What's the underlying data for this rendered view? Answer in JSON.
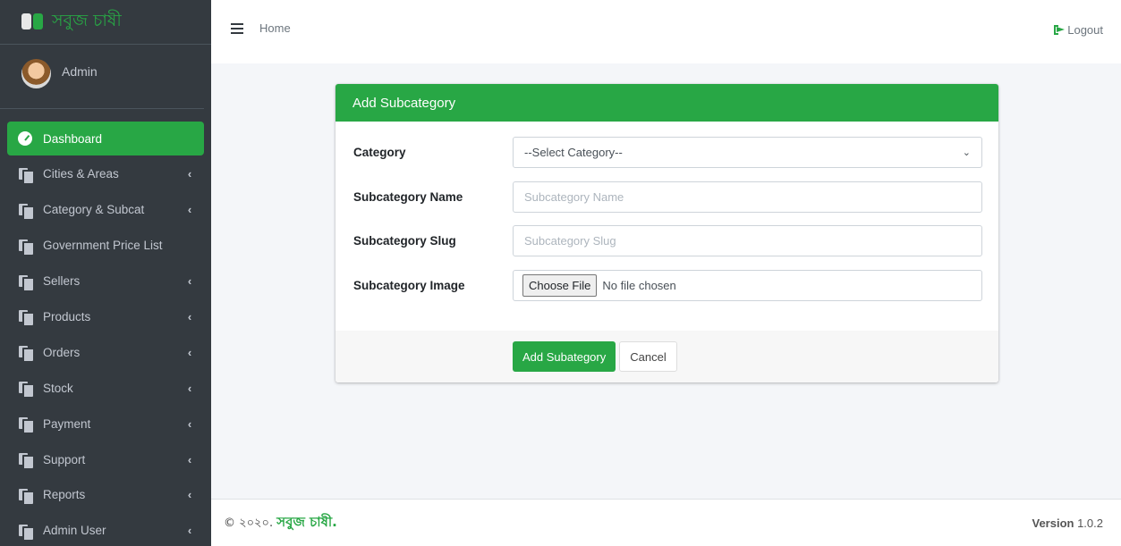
{
  "brand": {
    "name": "সবুজ চাষী"
  },
  "user": {
    "name": "Admin"
  },
  "sidebar": {
    "items": [
      {
        "label": "Dashboard",
        "icon": "dashboard-icon",
        "active": true,
        "chevron": ""
      },
      {
        "label": "Cities & Areas",
        "icon": "copy-icon",
        "chevron": "‹"
      },
      {
        "label": "Category & Subcat",
        "icon": "copy-icon",
        "chevron": "‹"
      },
      {
        "label": "Government Price List",
        "icon": "copy-icon",
        "chevron": ""
      },
      {
        "label": "Sellers",
        "icon": "copy-icon",
        "chevron": "‹"
      },
      {
        "label": "Products",
        "icon": "copy-icon",
        "chevron": "‹"
      },
      {
        "label": "Orders",
        "icon": "copy-icon",
        "chevron": "‹"
      },
      {
        "label": "Stock",
        "icon": "copy-icon",
        "chevron": "‹"
      },
      {
        "label": "Payment",
        "icon": "copy-icon",
        "chevron": "‹"
      },
      {
        "label": "Support",
        "icon": "copy-icon",
        "chevron": "‹"
      },
      {
        "label": "Reports",
        "icon": "copy-icon",
        "chevron": "‹"
      },
      {
        "label": "Admin User",
        "icon": "copy-icon",
        "chevron": "‹"
      }
    ]
  },
  "topbar": {
    "home_label": "Home",
    "logout_label": "Logout"
  },
  "card": {
    "title": "Add Subcategory",
    "fields": {
      "category": {
        "label": "Category",
        "value": "--Select Category--"
      },
      "name": {
        "label": "Subcategory Name",
        "placeholder": "Subcategory Name"
      },
      "slug": {
        "label": "Subcategory Slug",
        "placeholder": "Subcategory Slug"
      },
      "image": {
        "label": "Subcategory Image",
        "button": "Choose File",
        "status": "No file chosen"
      }
    },
    "submit_label": "Add Subategory",
    "cancel_label": "Cancel"
  },
  "footer": {
    "copyright_prefix": "© ২০২০.",
    "copyright_brand": "সবুজ চাষী.",
    "version_label": "Version",
    "version_value": "1.0.2"
  },
  "colors": {
    "accent": "#28a745",
    "sidebar_bg": "#343a40"
  }
}
